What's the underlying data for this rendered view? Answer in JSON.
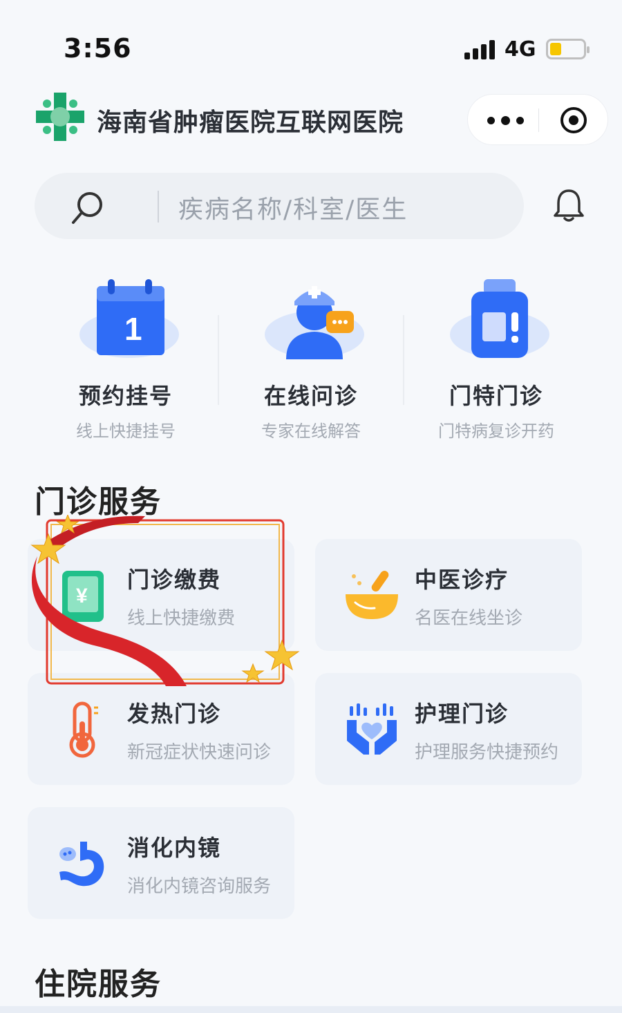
{
  "status_bar": {
    "time": "3:56",
    "network": "4G"
  },
  "header": {
    "title": "海南省肿瘤医院互联网医院"
  },
  "search": {
    "placeholder": "疾病名称/科室/医生"
  },
  "quick_actions": [
    {
      "title": "预约挂号",
      "subtitle": "线上快捷挂号",
      "icon": "calendar-icon"
    },
    {
      "title": "在线问诊",
      "subtitle": "专家在线解答",
      "icon": "doctor-chat-icon"
    },
    {
      "title": "门特门诊",
      "subtitle": "门特病复诊开药",
      "icon": "medicine-bottle-icon"
    }
  ],
  "calendar_day": "1",
  "sections": {
    "outpatient": "门诊服务",
    "inpatient": "住院服务"
  },
  "services": [
    {
      "title": "门诊缴费",
      "subtitle": "线上快捷缴费",
      "icon": "payment-icon"
    },
    {
      "title": "中医诊疗",
      "subtitle": "名医在线坐诊",
      "icon": "mortar-pestle-icon"
    },
    {
      "title": "发热门诊",
      "subtitle": "新冠症状快速问诊",
      "icon": "thermometer-icon"
    },
    {
      "title": "护理门诊",
      "subtitle": "护理服务快捷预约",
      "icon": "care-hands-icon"
    },
    {
      "title": "消化内镜",
      "subtitle": "消化内镜咨询服务",
      "icon": "stomach-icon"
    }
  ],
  "colors": {
    "primary_blue": "#2f6cf6",
    "light_blue": "#dbe6fb",
    "orange": "#f7a21b",
    "red": "#e8413a",
    "logo_green": "#1aa36a"
  }
}
